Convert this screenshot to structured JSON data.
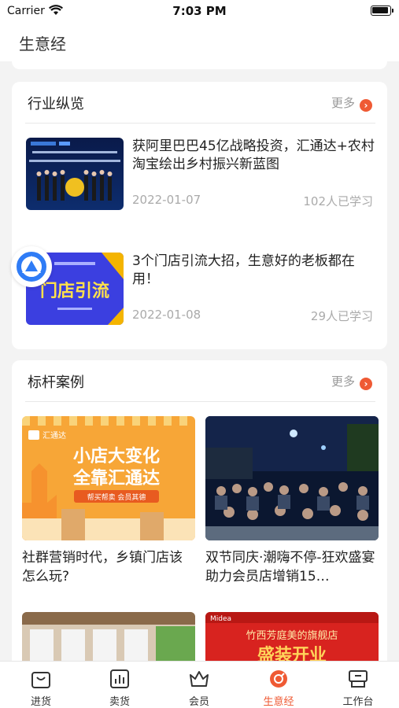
{
  "status": {
    "carrier": "Carrier",
    "time": "7:03 PM"
  },
  "nav": {
    "title": "生意经"
  },
  "industry": {
    "title": "行业纵览",
    "more": "更多",
    "items": [
      {
        "title": "获阿里巴巴45亿战略投资，汇通达+农村淘宝绘出乡村振兴新蓝图",
        "date": "2022-01-07",
        "count": "102人已学习",
        "thumb_text": "新华信共建农村商业新生态 阿里巴巴集团战略投资汇通达45亿人民币"
      },
      {
        "title": "3个门店引流大招，生意好的老板都在用！",
        "date": "2022-01-08",
        "count": "29人已学习",
        "thumb_text": "门店引流"
      }
    ]
  },
  "cases": {
    "title": "标杆案例",
    "more": "更多",
    "items": [
      {
        "title": "社群营销时代，乡镇门店该怎么玩?",
        "banner_line1": "小店大变化",
        "banner_line2": "全靠汇通达",
        "banner_tag": "帮买帮卖  会员其德",
        "logo_text": "汇通达"
      },
      {
        "title": "双节同庆·潮嗨不停-狂欢盛宴助力会员店增销15…"
      },
      {
        "title": ""
      },
      {
        "title": "",
        "banner_text": "竹西芳庭美的旗舰店",
        "banner_big": "盛装开业",
        "brand": "Midea"
      }
    ]
  },
  "tabs": [
    {
      "label": "进货",
      "icon": "bag-icon"
    },
    {
      "label": "卖货",
      "icon": "chart-icon"
    },
    {
      "label": "会员",
      "icon": "crown-icon"
    },
    {
      "label": "生意经",
      "icon": "compass-icon",
      "active": true
    },
    {
      "label": "工作台",
      "icon": "workbench-icon"
    }
  ],
  "colors": {
    "accent": "#ef5a34",
    "background": "#f3f3f3"
  }
}
